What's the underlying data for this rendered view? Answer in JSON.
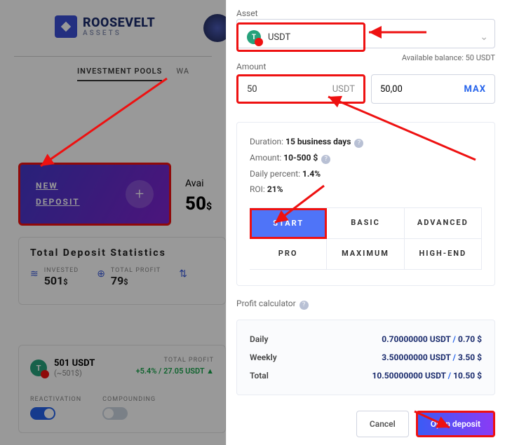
{
  "brand": {
    "name": "ROOSEVELT",
    "sub": "ASSETS"
  },
  "tabs": {
    "pools": "INVESTMENT POOLS",
    "wa": "WA"
  },
  "newDeposit": {
    "line1": "NEW",
    "line2": "DEPOSIT"
  },
  "available": {
    "label": "Avai",
    "value": "50",
    "unit": "$"
  },
  "stats": {
    "title": "Total Deposit Statistics",
    "invested": {
      "label": "INVESTED",
      "value": "501",
      "unit": "$"
    },
    "profit": {
      "label": "TOTAL PROFIT",
      "value": "79",
      "unit": "$"
    }
  },
  "depCard": {
    "amount": "501 USDT",
    "sub": "(~501$)",
    "profitLabel": "TOTAL PROFIT",
    "profitValue": "+5.4% / 27.05 USDT ▲",
    "reactivation": "REACTIVATION",
    "compounding": "COMPOUNDING"
  },
  "panel": {
    "assetLabel": "Asset",
    "asset": "USDT",
    "amountLabel": "Amount",
    "amount": "50",
    "amountUnit": "USDT",
    "amountDisplay": "50,00",
    "max": "MAX",
    "availBalance": "Available balance: 50 USDT",
    "info": {
      "durationK": "Duration:",
      "durationV": "15 business days",
      "amountK": "Amount:",
      "amountV": "10-500 $",
      "dailyK": "Daily percent:",
      "dailyV": "1.4%",
      "roiK": "ROI:",
      "roiV": "21%"
    },
    "plans": [
      "START",
      "BASIC",
      "ADVANCED",
      "PRO",
      "MAXIMUM",
      "HIGH-END"
    ],
    "calcLabel": "Profit calculator",
    "calc": {
      "daily": {
        "k": "Daily",
        "v": "0.70000000 USDT",
        "usd": "0.70 $"
      },
      "weekly": {
        "k": "Weekly",
        "v": "3.50000000 USDT",
        "usd": "3.50 $"
      },
      "total": {
        "k": "Total",
        "v": "10.50000000 USDT",
        "usd": "10.50 $"
      }
    },
    "cancel": "Cancel",
    "open": "Open deposit"
  }
}
